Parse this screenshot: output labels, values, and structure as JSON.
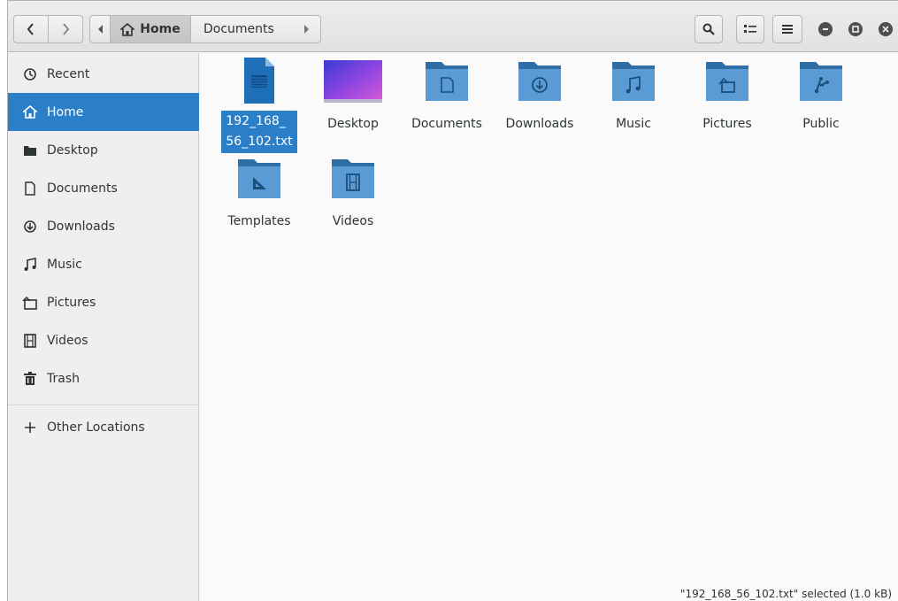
{
  "header": {
    "path_home_label": "Home",
    "path_current_label": "Documents"
  },
  "sidebar": {
    "items": [
      {
        "label": "Recent",
        "icon": "clock-icon"
      },
      {
        "label": "Home",
        "icon": "home-icon",
        "active": true
      },
      {
        "label": "Desktop",
        "icon": "desktop-icon"
      },
      {
        "label": "Documents",
        "icon": "document-icon"
      },
      {
        "label": "Downloads",
        "icon": "download-icon"
      },
      {
        "label": "Music",
        "icon": "music-icon"
      },
      {
        "label": "Pictures",
        "icon": "picture-icon"
      },
      {
        "label": "Videos",
        "icon": "video-icon"
      },
      {
        "label": "Trash",
        "icon": "trash-icon"
      }
    ],
    "other_locations_label": "Other Locations"
  },
  "files": [
    {
      "name_line1": "192_168_",
      "name_line2": "56_102.txt",
      "type": "text-file",
      "selected": true
    },
    {
      "name": "Desktop",
      "type": "desktop-folder"
    },
    {
      "name": "Documents",
      "type": "folder",
      "emblem": "document-icon"
    },
    {
      "name": "Downloads",
      "type": "folder",
      "emblem": "download-icon"
    },
    {
      "name": "Music",
      "type": "folder",
      "emblem": "music-icon"
    },
    {
      "name": "Pictures",
      "type": "folder",
      "emblem": "picture-icon"
    },
    {
      "name": "Public",
      "type": "folder",
      "emblem": "share-icon"
    },
    {
      "name": "Templates",
      "type": "folder",
      "emblem": "template-icon"
    },
    {
      "name": "Videos",
      "type": "folder",
      "emblem": "video-icon"
    }
  ],
  "status": "\"192_168_56_102.txt\" selected  (1.0 kB)",
  "colors": {
    "accent": "#2a7fc8",
    "folder_top": "#2f6fa5",
    "folder_body": "#5b9bd5"
  }
}
